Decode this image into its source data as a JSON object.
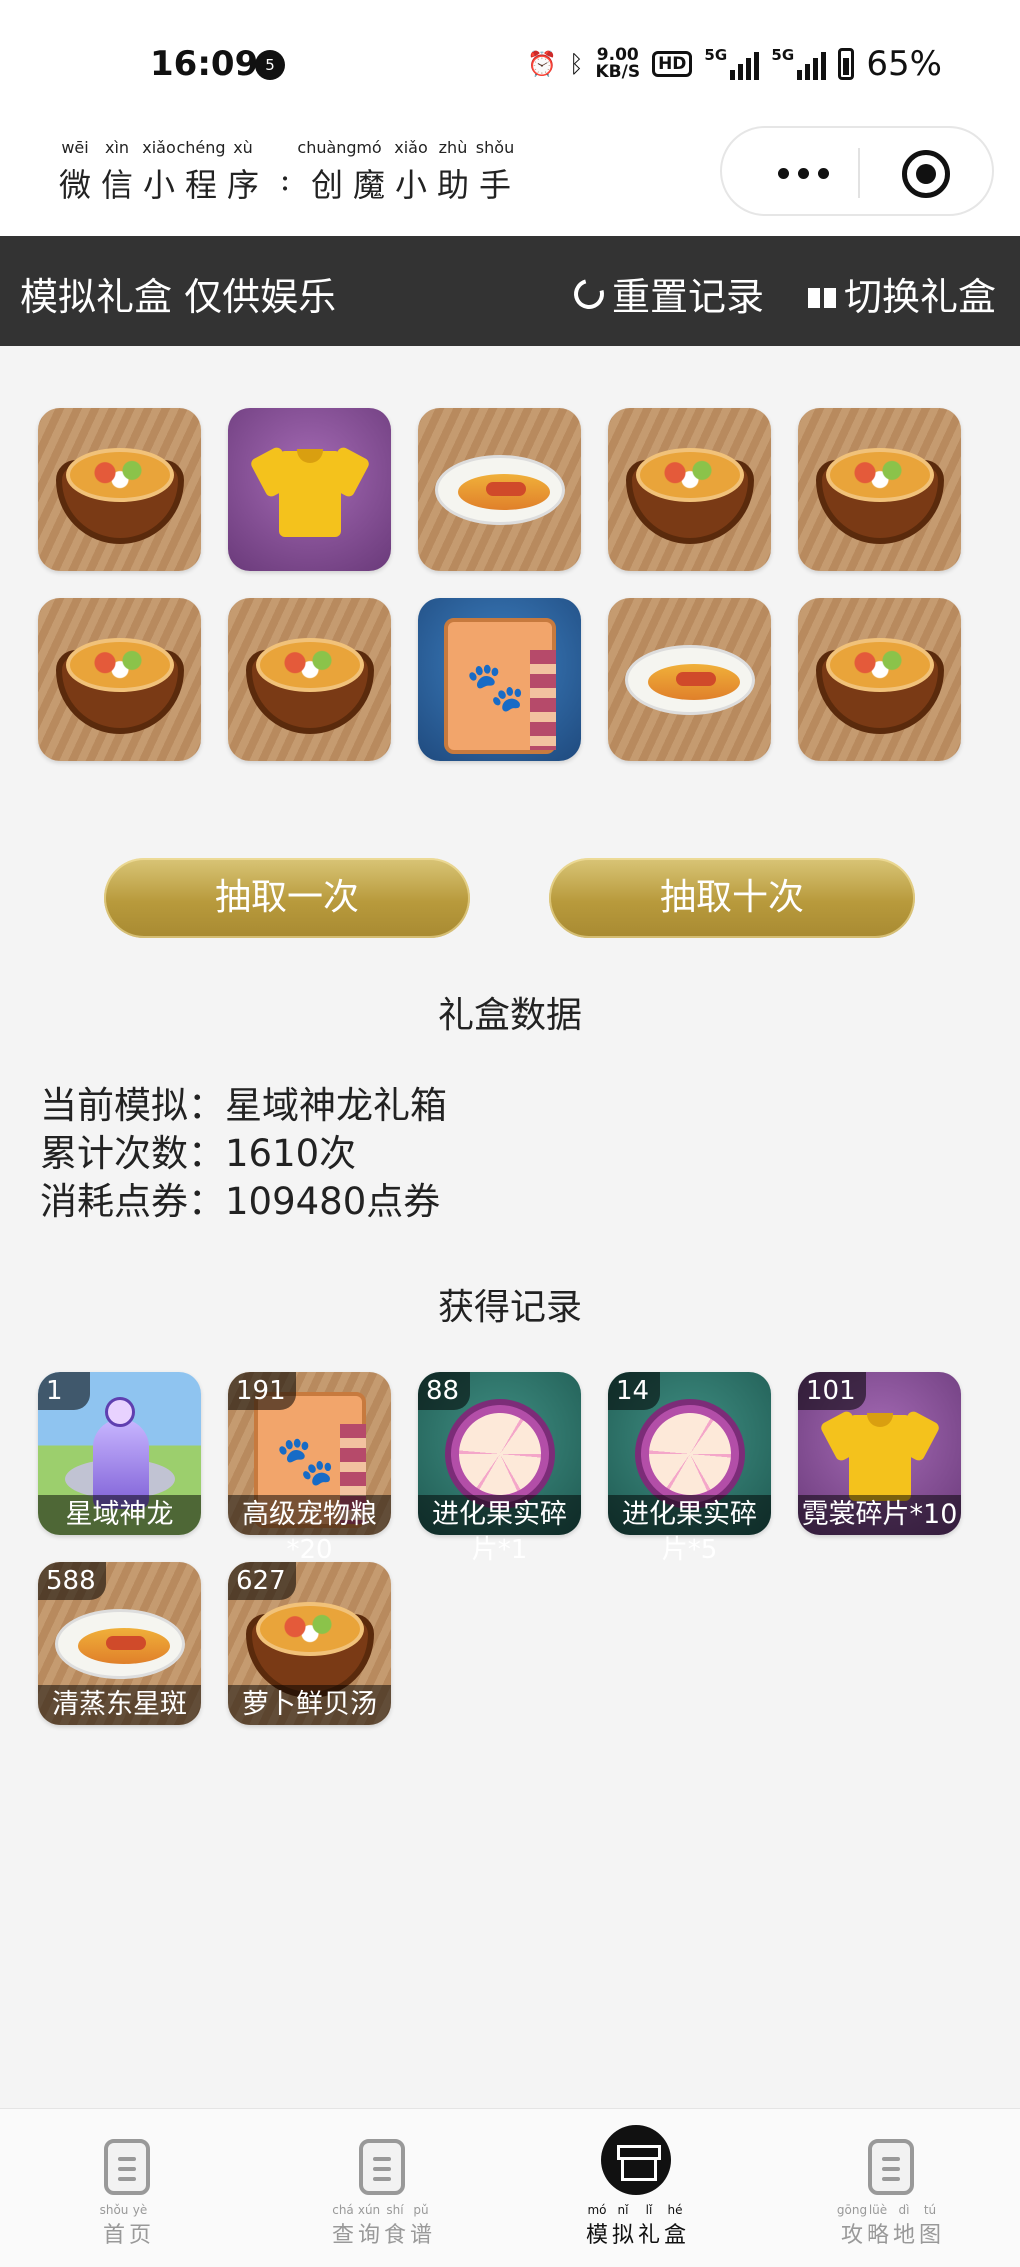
{
  "status_bar": {
    "time": "16:09",
    "notification_count": "5",
    "speed_value": "9.00",
    "speed_unit": "KB/S",
    "hd_label": "HD",
    "signal1_label": "5G",
    "signal2_label": "5G",
    "battery": "65%"
  },
  "header": {
    "title_chars": [
      {
        "py": "wēi",
        "hz": "微"
      },
      {
        "py": "xìn",
        "hz": "信"
      },
      {
        "py": "xiǎo",
        "hz": "小"
      },
      {
        "py": "chéng",
        "hz": "程"
      },
      {
        "py": "xù",
        "hz": "序"
      },
      {
        "py": "",
        "hz": ":"
      },
      {
        "py": "chuàng",
        "hz": "创"
      },
      {
        "py": "mó",
        "hz": "魔"
      },
      {
        "py": "xiǎo",
        "hz": "小"
      },
      {
        "py": "zhù",
        "hz": "助"
      },
      {
        "py": "shǒu",
        "hz": "手"
      }
    ]
  },
  "toolbar": {
    "title": "模拟礼盒 仅供娱乐",
    "reset_label": "重置记录",
    "switch_label": "切换礼盒"
  },
  "draw_result": [
    {
      "art": "soup",
      "bg": "wood"
    },
    {
      "art": "shirt",
      "bg": "purple"
    },
    {
      "art": "fish",
      "bg": "wood"
    },
    {
      "art": "soup",
      "bg": "wood"
    },
    {
      "art": "soup",
      "bg": "wood"
    },
    {
      "art": "soup",
      "bg": "wood"
    },
    {
      "art": "soup",
      "bg": "wood"
    },
    {
      "art": "bag",
      "bg": "blue"
    },
    {
      "art": "fish",
      "bg": "wood"
    },
    {
      "art": "soup",
      "bg": "wood"
    }
  ],
  "buttons": {
    "draw_once": "抽取一次",
    "draw_ten": "抽取十次"
  },
  "stats": {
    "title": "礼盒数据",
    "current_label": "当前模拟：",
    "current_value": "星域神龙礼箱",
    "total_label": "累计次数：",
    "total_value": "1610次",
    "cost_label": "消耗点券：",
    "cost_value": "109480点券"
  },
  "records": {
    "title": "获得记录",
    "items": [
      {
        "count": "1",
        "name": "星域神龙",
        "overflow": "",
        "art": "dragon",
        "bg": "scene"
      },
      {
        "count": "191",
        "name": "高级宠物粮",
        "overflow": "*20",
        "art": "bag",
        "bg": "wood"
      },
      {
        "count": "88",
        "name": "进化果实碎",
        "overflow": "片*1",
        "art": "fruit",
        "bg": "teal"
      },
      {
        "count": "14",
        "name": "进化果实碎",
        "overflow": "片*5",
        "art": "fruit",
        "bg": "teal"
      },
      {
        "count": "101",
        "name": "霓裳碎片*10",
        "overflow": "",
        "art": "shirt",
        "bg": "purple"
      },
      {
        "count": "588",
        "name": "清蒸东星斑",
        "overflow": "",
        "art": "fish",
        "bg": "wood"
      },
      {
        "count": "627",
        "name": "萝卜鲜贝汤",
        "overflow": "",
        "art": "soup",
        "bg": "wood"
      }
    ]
  },
  "bottom_nav": [
    {
      "id": "home",
      "chars": [
        {
          "py": "shǒu",
          "hz": "首"
        },
        {
          "py": "yè",
          "hz": "页"
        }
      ],
      "active": false
    },
    {
      "id": "recipes",
      "chars": [
        {
          "py": "chá",
          "hz": "查"
        },
        {
          "py": "xún",
          "hz": "询"
        },
        {
          "py": "shí",
          "hz": "食"
        },
        {
          "py": "pǔ",
          "hz": "谱"
        }
      ],
      "active": false
    },
    {
      "id": "giftbox",
      "chars": [
        {
          "py": "mó",
          "hz": "模"
        },
        {
          "py": "nǐ",
          "hz": "拟"
        },
        {
          "py": "lǐ",
          "hz": "礼"
        },
        {
          "py": "hé",
          "hz": "盒"
        }
      ],
      "active": true
    },
    {
      "id": "guide-map",
      "chars": [
        {
          "py": "gōng",
          "hz": "攻"
        },
        {
          "py": "lüè",
          "hz": "略"
        },
        {
          "py": "dì",
          "hz": "地"
        },
        {
          "py": "tú",
          "hz": "图"
        }
      ],
      "active": false
    }
  ]
}
